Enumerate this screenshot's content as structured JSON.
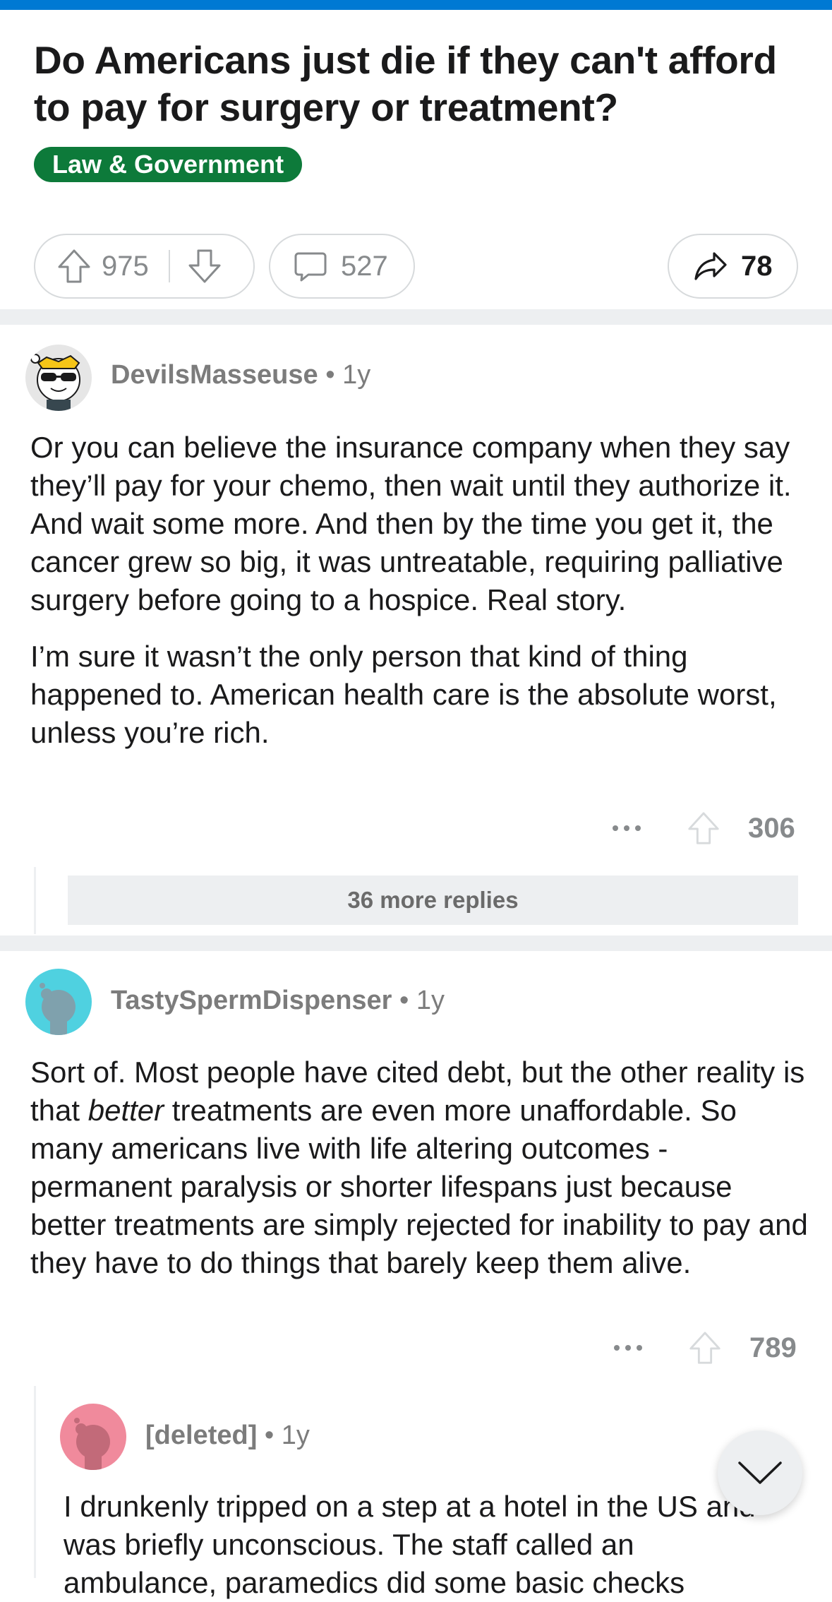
{
  "post": {
    "title": "Do Americans just die if they can't afford to pay for surgery or treatment?",
    "flair": "Law & Government",
    "upvotes": "975",
    "comments": "527",
    "shares": "78"
  },
  "comments": [
    {
      "author": "DevilsMasseuse",
      "age": "1y",
      "paragraphs": [
        "Or you can believe the insurance company when they say they’ll pay for your chemo, then wait until they authorize it. And wait some more. And then by the time you get it, the cancer grew so big, it was untreatable, requiring palliative surgery before going to a hospice. Real story.",
        "I’m sure it wasn’t the only person that kind of thing happened to. American health care is the absolute worst, unless you’re rich."
      ],
      "score": "306",
      "more_replies": "36 more replies"
    },
    {
      "author": "TastySpermDispenser",
      "age": "1y",
      "text_before": "Sort of. Most people have cited debt, but the other reality is that ",
      "text_em": "better",
      "text_after": " treatments are even more unaffordable. So many americans live with life altering outcomes - permanent paralysis or shorter lifespans just because better treatments are simply rejected for inability to pay and they have to do things that barely keep them alive.",
      "score": "789"
    },
    {
      "author": "[deleted]",
      "age": "1y",
      "text": "I drunkenly tripped on a step at a hotel in the US and was briefly unconscious. The staff called an ambulance, paramedics did some basic checks"
    }
  ],
  "colors": {
    "accent": "#0079d3",
    "flair_bg": "#0d7a3a",
    "separator": "#edeff1",
    "teal_avatar": "#4fd1e0",
    "pink_avatar": "#f08a9c"
  },
  "icons": [
    "upvote-icon",
    "downvote-icon",
    "comment-icon",
    "share-icon",
    "more-icon",
    "chevron-down-icon"
  ]
}
